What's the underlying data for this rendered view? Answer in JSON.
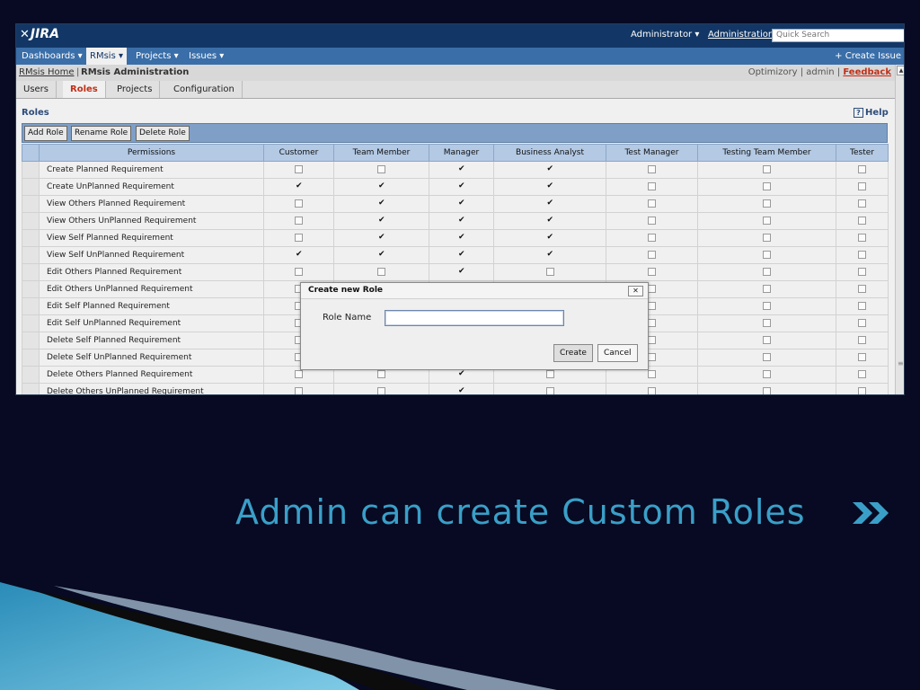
{
  "jira": {
    "logo": "JIRA",
    "user_menu": "Administrator",
    "admin_link": "Administration",
    "search_placeholder": "Quick Search"
  },
  "nav": {
    "items": [
      "Dashboards",
      "RMsis",
      "Projects",
      "Issues"
    ],
    "active": "RMsis",
    "create_issue": "Create Issue"
  },
  "rmsis_bar": {
    "home": "RMsis Home",
    "title": "RMsis Administration",
    "org": "Optimizory",
    "user": "admin",
    "feedback": "Feedback"
  },
  "tabs": [
    "Users",
    "Roles",
    "Projects",
    "Configuration"
  ],
  "active_tab": "Roles",
  "section_title": "Roles",
  "help": "Help",
  "buttons": {
    "add_role": "Add Role",
    "rename_role": "Rename Role",
    "delete_role": "Delete Role"
  },
  "table": {
    "columns": [
      "Permissions",
      "Customer",
      "Team Member",
      "Manager",
      "Business Analyst",
      "Test Manager",
      "Testing Team Member",
      "Tester"
    ],
    "rows": [
      {
        "permission": "Create Planned Requirement",
        "checks": [
          false,
          false,
          true,
          true,
          false,
          false,
          false
        ]
      },
      {
        "permission": "Create UnPlanned Requirement",
        "checks": [
          true,
          true,
          true,
          true,
          false,
          false,
          false
        ]
      },
      {
        "permission": "View Others Planned Requirement",
        "checks": [
          false,
          true,
          true,
          true,
          false,
          false,
          false
        ]
      },
      {
        "permission": "View Others UnPlanned Requirement",
        "checks": [
          false,
          true,
          true,
          true,
          false,
          false,
          false
        ]
      },
      {
        "permission": "View Self Planned Requirement",
        "checks": [
          false,
          true,
          true,
          true,
          false,
          false,
          false
        ]
      },
      {
        "permission": "View Self UnPlanned Requirement",
        "checks": [
          true,
          true,
          true,
          true,
          false,
          false,
          false
        ]
      },
      {
        "permission": "Edit Others Planned Requirement",
        "checks": [
          false,
          false,
          true,
          false,
          false,
          false,
          false
        ]
      },
      {
        "permission": "Edit Others UnPlanned Requirement",
        "checks": [
          false,
          false,
          false,
          false,
          false,
          false,
          false
        ]
      },
      {
        "permission": "Edit Self Planned Requirement",
        "checks": [
          false,
          false,
          false,
          false,
          false,
          false,
          false
        ]
      },
      {
        "permission": "Edit Self UnPlanned Requirement",
        "checks": [
          false,
          false,
          false,
          false,
          false,
          false,
          false
        ]
      },
      {
        "permission": "Delete Self Planned Requirement",
        "checks": [
          false,
          false,
          false,
          false,
          false,
          false,
          false
        ]
      },
      {
        "permission": "Delete Self UnPlanned Requirement",
        "checks": [
          false,
          false,
          false,
          false,
          false,
          false,
          false
        ]
      },
      {
        "permission": "Delete Others Planned Requirement",
        "checks": [
          false,
          false,
          true,
          false,
          false,
          false,
          false
        ]
      },
      {
        "permission": "Delete Others UnPlanned Requirement",
        "checks": [
          false,
          false,
          true,
          false,
          false,
          false,
          false
        ]
      }
    ]
  },
  "dialog": {
    "title": "Create new Role",
    "field_label": "Role Name",
    "field_value": "",
    "create": "Create",
    "cancel": "Cancel"
  },
  "slide": {
    "title": "Admin can create Custom Roles",
    "title_color": "#3a9fc8",
    "background": "#070a22"
  }
}
